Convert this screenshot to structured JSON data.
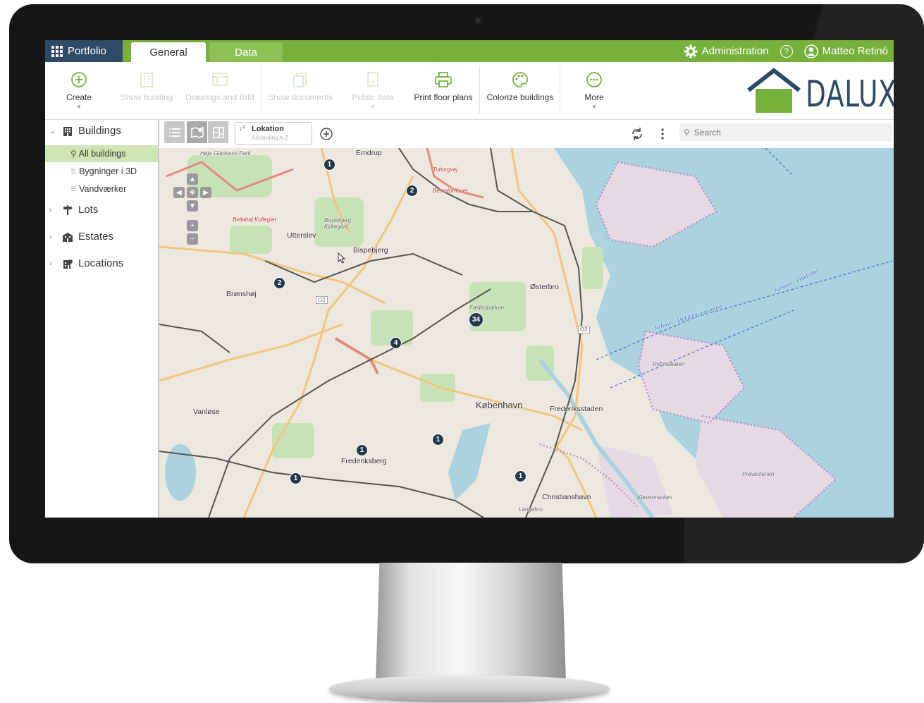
{
  "topbar": {
    "portfolio_label": "Portfolio",
    "tabs": [
      {
        "label": "General",
        "active": true
      },
      {
        "label": "Data",
        "active": false
      }
    ],
    "administration_label": "Administration",
    "user_name": "Matteo Retinó",
    "accent_color": "#77b13c",
    "portfolio_color": "#2e4a66"
  },
  "ribbon": {
    "buttons": [
      {
        "label": "Create",
        "icon": "plus-circle-icon",
        "enabled": true
      },
      {
        "label": "Show building",
        "icon": "building-icon",
        "enabled": false
      },
      {
        "label": "Drawings and BIM",
        "icon": "drawings-icon",
        "enabled": false
      },
      {
        "label": "Show documents",
        "icon": "documents-icon",
        "enabled": false
      },
      {
        "label": "Public data",
        "icon": "public-data-icon",
        "enabled": false
      },
      {
        "label": "Print floor plans",
        "icon": "printer-icon",
        "enabled": true
      },
      {
        "label": "Colorize buildings",
        "icon": "palette-icon",
        "enabled": true
      },
      {
        "label": "More",
        "icon": "more-icon",
        "enabled": true
      }
    ],
    "logo_text": "DALUX"
  },
  "sidebar": {
    "groups": [
      {
        "label": "Buildings",
        "expanded": true,
        "items": [
          {
            "label": "All buildings",
            "active": true
          },
          {
            "label": "Bygninger i 3D",
            "active": false
          },
          {
            "label": "Vandværker",
            "active": false
          }
        ]
      },
      {
        "label": "Lots",
        "expanded": false
      },
      {
        "label": "Estates",
        "expanded": false
      },
      {
        "label": "Locations",
        "expanded": false
      }
    ]
  },
  "maptoolbar": {
    "sort_title": "Lokation",
    "sort_subtitle": "Ascending A-Z",
    "search_placeholder": "Search"
  },
  "map": {
    "labels": [
      "Emdrup",
      "Utterslev",
      "Bispebjerg",
      "Brønshøj",
      "Østerbro",
      "København",
      "Frederiksstaden",
      "Vanløse",
      "Frederiksberg",
      "Christianshavn",
      "Langebro",
      "Refshaleøen",
      "Prøvestenen",
      "Kløvermarken",
      "Fælledparken",
      "Bispebjerg Kirkegård",
      "Høje Gladsaxe Park",
      "Tuborgvej",
      "Bernstorffsvej",
      "Nyhavn - Middelgrundsfortet",
      "Nyhavn - Flakfortet",
      "Bellahøj Kollegiet",
      "O2"
    ],
    "pins": [
      "1",
      "2",
      "2",
      "34",
      "4",
      "1",
      "1",
      "1",
      "1"
    ]
  }
}
